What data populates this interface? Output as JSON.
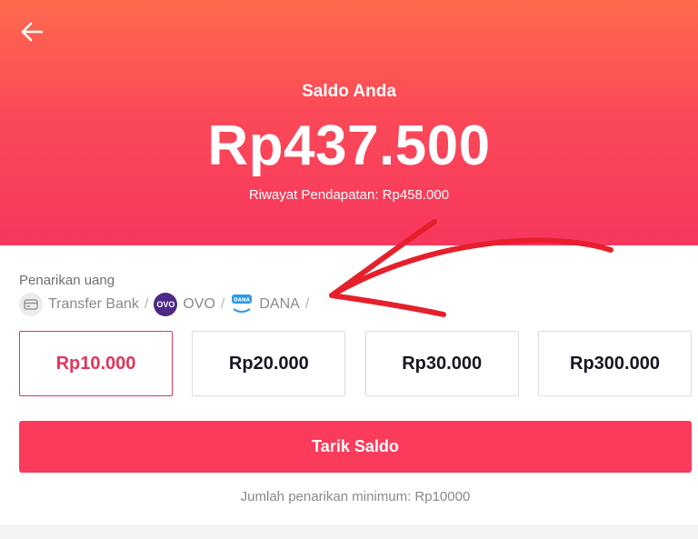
{
  "header": {
    "back_icon": "arrow-left-icon",
    "balance_label": "Saldo Anda",
    "balance_amount": "Rp437.500",
    "history_text": "Riwayat Pendapatan: Rp458.000"
  },
  "withdraw": {
    "section_title": "Penarikan uang",
    "methods": [
      {
        "label": "Transfer Bank",
        "icon": "bank-card-icon"
      },
      {
        "label": "OVO",
        "icon": "ovo-logo-icon",
        "icon_text": "OVO"
      },
      {
        "label": "DANA",
        "icon": "dana-logo-icon",
        "icon_text": "DANA"
      }
    ],
    "separator": "/",
    "amounts": [
      "Rp10.000",
      "Rp20.000",
      "Rp30.000",
      "Rp300.000"
    ],
    "selected_amount": "Rp10.000",
    "button_label": "Tarik Saldo",
    "min_note": "Jumlah penarikan minimum: Rp10000"
  },
  "colors": {
    "header_top": "#fd6a4e",
    "header_bottom": "#f7375f",
    "accent": "#fb3b5c",
    "selected_border": "#e0355a",
    "annotation_arrow": "#e5202c"
  }
}
